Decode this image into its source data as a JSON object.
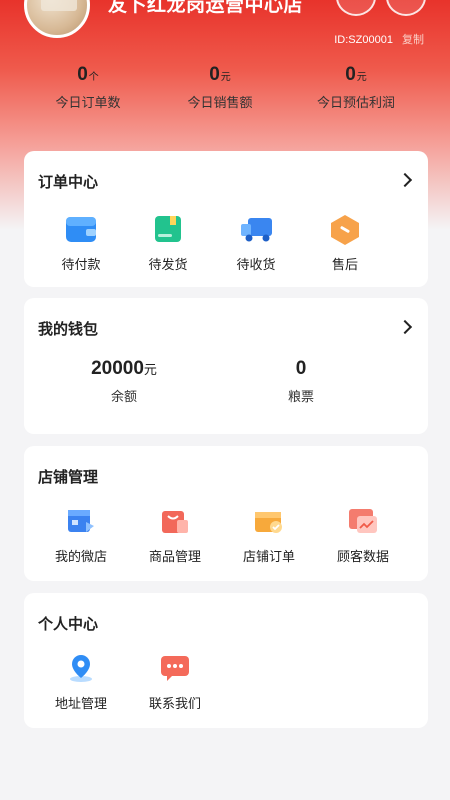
{
  "store": {
    "name": "友卜红龙岗运营中心店",
    "id_label": "ID:SZ00001",
    "copy_label": "复制"
  },
  "stats": [
    {
      "value": "0",
      "unit": "个",
      "label": "今日订单数"
    },
    {
      "value": "0",
      "unit": "元",
      "label": "今日销售额"
    },
    {
      "value": "0",
      "unit": "元",
      "label": "今日预估利润"
    }
  ],
  "orders": {
    "title": "订单中心",
    "items": [
      {
        "label": "待付款",
        "icon": "wallet-icon"
      },
      {
        "label": "待发货",
        "icon": "package-icon"
      },
      {
        "label": "待收货",
        "icon": "truck-icon"
      },
      {
        "label": "售后",
        "icon": "after-sales-icon"
      }
    ]
  },
  "wallet": {
    "title": "我的钱包",
    "balance_value": "20000",
    "balance_unit": "元",
    "balance_label": "余额",
    "coupon_value": "0",
    "coupon_label": "粮票"
  },
  "shop": {
    "title": "店铺管理",
    "items": [
      {
        "label": "我的微店",
        "icon": "shop-icon"
      },
      {
        "label": "商品管理",
        "icon": "goods-bag-icon"
      },
      {
        "label": "店铺订单",
        "icon": "order-box-icon"
      },
      {
        "label": "顾客数据",
        "icon": "data-chart-icon"
      }
    ]
  },
  "personal": {
    "title": "个人中心",
    "items": [
      {
        "label": "地址管理",
        "icon": "location-pin-icon"
      },
      {
        "label": "联系我们",
        "icon": "chat-bubble-icon"
      }
    ]
  },
  "colors": {
    "brand": "#e8332b",
    "card_bg": "#ffffff",
    "page_bg": "#f4f4f6"
  }
}
